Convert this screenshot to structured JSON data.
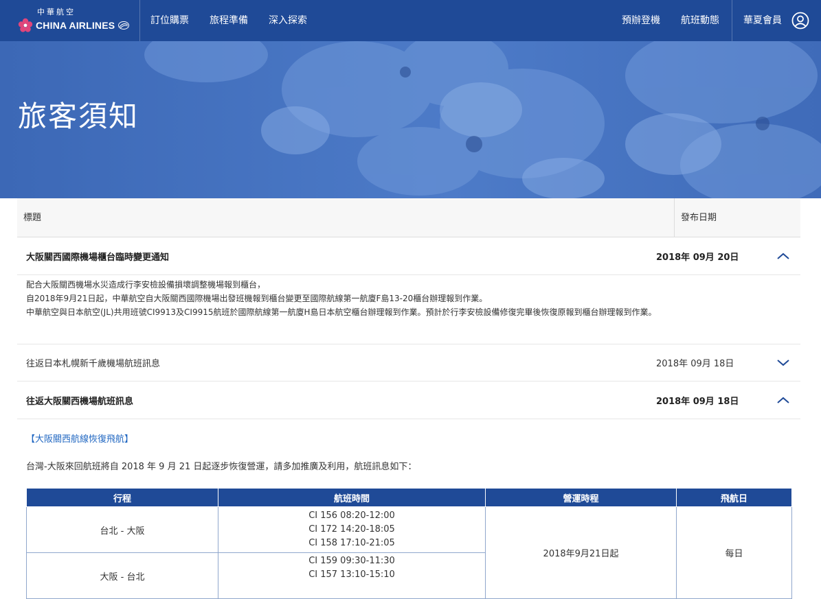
{
  "header": {
    "logo_cn": "中華航空",
    "logo_en": "CHINA AIRLINES",
    "nav_left": [
      "訂位購票",
      "旅程準備",
      "深入探索"
    ],
    "nav_right": [
      "預辦登機",
      "航班動態"
    ],
    "member_label": "華夏會員",
    "brand_color": "#1f4a97"
  },
  "hero": {
    "title": "旅客須知"
  },
  "table": {
    "col_title": "標題",
    "col_date": "發布日期"
  },
  "notices": [
    {
      "title": "大阪關西國際機場櫃台臨時變更通知",
      "date": "2018年 09月 20日",
      "expanded": true,
      "body": [
        "配合大阪關西機場水災造成行李安檢設備損壞調整機場報到櫃台，",
        "自2018年9月21日起，中華航空自大阪關西國際機場出發班機報到櫃台變更至國際航線第一航廈F島13-20櫃台辦理報到作業。",
        "中華航空與日本航空(JL)共用班號CI9913及CI9915航班於國際航線第一航廈H島日本航空櫃台辦理報到作業。預計於行李安檢設備修復完畢後恢復原報到櫃台辦理報到作業。"
      ]
    },
    {
      "title": "往返日本札幌新千歲機場航班訊息",
      "date": "2018年 09月 18日",
      "expanded": false
    },
    {
      "title": "往返大阪關西機場航班訊息",
      "date": "2018年 09月 18日",
      "expanded": true,
      "subhead": "【大阪關西航線恢復飛航】",
      "intro": "台灣-大阪來回航班將自 2018 年 9 月 21 日起逐步恢復營運，請多加推廣及利用，航班訊息如下：",
      "flight_table": {
        "headers": [
          "行程",
          "航班時間",
          "營運時程",
          "飛航日"
        ],
        "rows": [
          {
            "route": "台北 - 大阪",
            "times": [
              "CI 156 08:20-12:00",
              "CI 172 14:20-18:05",
              "CI 158 17:10-21:05"
            ]
          },
          {
            "route": "大阪 - 台北",
            "times": [
              "CI 159 09:30-11:30",
              "CI 157 13:10-15:10"
            ]
          }
        ],
        "schedule": "2018年9月21日起",
        "days": "每日"
      }
    }
  ]
}
